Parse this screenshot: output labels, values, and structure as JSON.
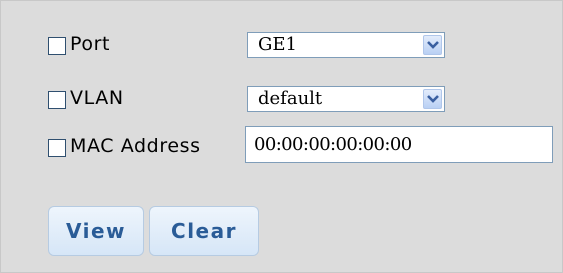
{
  "filters": {
    "port": {
      "label": "Port",
      "checked": false,
      "selected": "GE1"
    },
    "vlan": {
      "label": "VLAN",
      "checked": false,
      "selected": "default"
    },
    "mac": {
      "label": "MAC Address",
      "checked": false,
      "value": "00:00:00:00:00:00"
    }
  },
  "actions": {
    "view_label": "View",
    "clear_label": "Clear"
  },
  "colors": {
    "panel_bg": "#dcdcdc",
    "button_text": "#2a5c97",
    "input_border": "#7f9db9"
  },
  "icons": {
    "dropdown": "chevron-down-icon"
  }
}
